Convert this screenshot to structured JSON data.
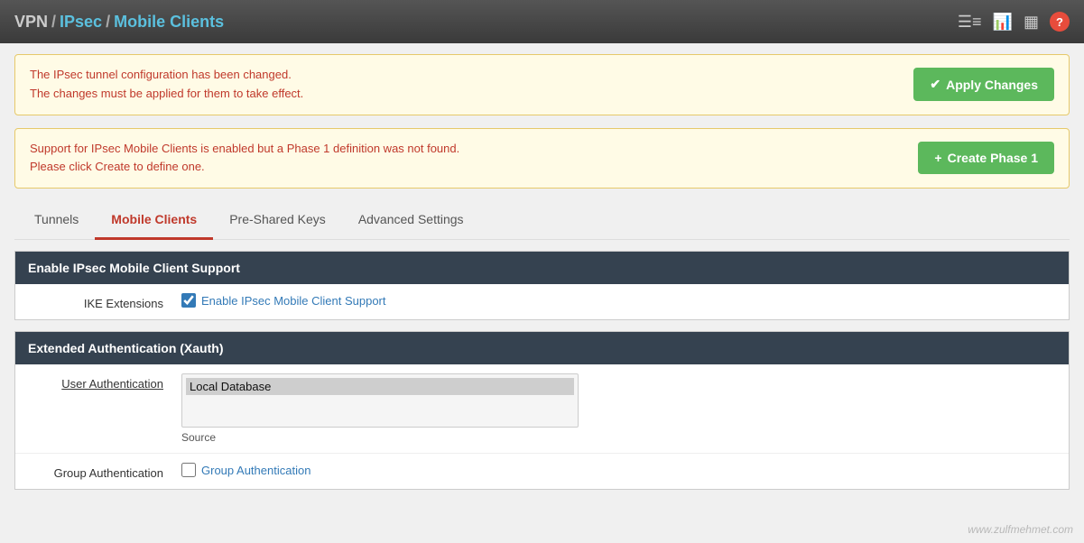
{
  "breadcrumb": {
    "vpn": "VPN",
    "sep1": "/",
    "ipsec": "IPsec",
    "sep2": "/",
    "mobile": "Mobile Clients"
  },
  "topbar": {
    "icons": [
      "sliders-icon",
      "chart-icon",
      "table-icon",
      "help-icon"
    ]
  },
  "alerts": [
    {
      "id": "config-changed",
      "line1": "The IPsec tunnel configuration has been changed.",
      "line2": "The changes must be applied for them to take effect.",
      "button": "Apply Changes"
    },
    {
      "id": "no-phase1",
      "line1": "Support for IPsec Mobile Clients is enabled but a Phase 1 definition was not found.",
      "line2": "Please click Create to define one.",
      "button": "Create Phase 1"
    }
  ],
  "tabs": [
    {
      "id": "tunnels",
      "label": "Tunnels",
      "active": false
    },
    {
      "id": "mobile-clients",
      "label": "Mobile Clients",
      "active": true
    },
    {
      "id": "pre-shared-keys",
      "label": "Pre-Shared Keys",
      "active": false
    },
    {
      "id": "advanced-settings",
      "label": "Advanced Settings",
      "active": false
    }
  ],
  "sections": {
    "ipsec_mobile": {
      "header": "Enable IPsec Mobile Client Support",
      "ike_label": "IKE Extensions",
      "ike_checkbox_label": "Enable IPsec Mobile Client Support",
      "ike_checked": true
    },
    "xauth": {
      "header": "Extended Authentication (Xauth)",
      "user_auth_label": "User Authentication",
      "user_auth_options": [
        "Local Database"
      ],
      "user_auth_selected": "Local Database",
      "source_label": "Source",
      "group_auth_label": "Group Authentication",
      "group_auth_checkbox_label": "Group Authentication",
      "group_auth_checked": false
    }
  },
  "watermark": "www.zulfmehmet.com"
}
